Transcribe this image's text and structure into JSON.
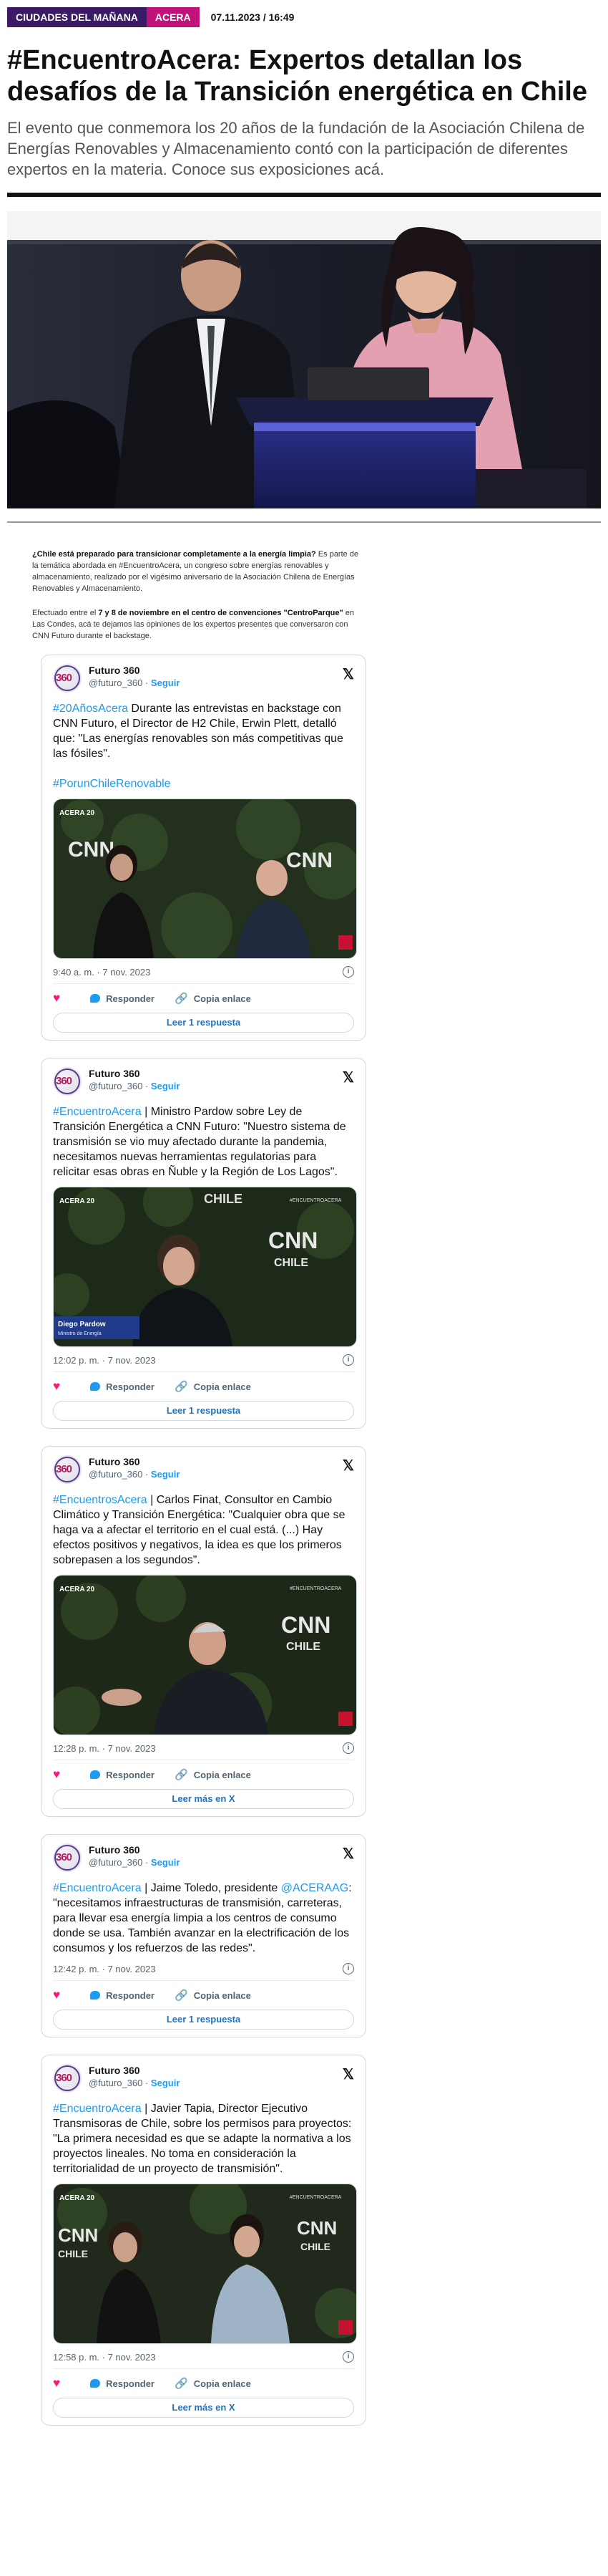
{
  "header": {
    "section": "CIUDADES DEL MAÑANA",
    "category": "ACERA",
    "date": "07.11.2023 / 16:49"
  },
  "article": {
    "title": "#EncuentroAcera: Expertos detallan los desafíos de la Transición energética en Chile",
    "dek": "El evento que conmemora los 20 años de la fundación de la Asociación Chilena de Energías Renovables y Almacenamiento contó con la participación de diferentes expertos en la materia. Conoce sus exposiciones acá.",
    "p1_bold": "¿Chile está preparado para transicionar completamente a la energía limpia?",
    "p1_rest": " Es parte de la temática abordada en #EncuentroAcera, un congreso sobre energías renovables y almacenamiento, realizado por el vigésimo aniversario de la Asociación Chilena de Energías Renovables y Almacenamiento.",
    "p2_a": "Efectuado entre el ",
    "p2_bold1": "7 y 8 de noviembre en el centro de convenciones \"CentroParque\"",
    "p2_b": " en Las Condes, acá te dejamos las opiniones de los expertos presentes que conversaron con CNN Futuro durante el backstage."
  },
  "tweets": [
    {
      "name": "Futuro 360",
      "handle": "@futuro_360",
      "follow": "Seguir",
      "hashtag": "#20AñosAcera",
      "text": " Durante las entrevistas en backstage con CNN Futuro, el Director de H2 Chile, Erwin Plett, detalló que:  \"Las energías renovables son más competitivas que las fósiles\".",
      "tail_hashtag": "#PorunChileRenovable",
      "time": "9:40 a. m. · 7 nov. 2023",
      "reply": "Responder",
      "copy": "Copia enlace",
      "more": "Leer 1 respuesta"
    },
    {
      "name": "Futuro 360",
      "handle": "@futuro_360",
      "follow": "Seguir",
      "hashtag": "#EncuentroAcera",
      "text": " | Ministro Pardow sobre Ley de Transición Energética a CNN Futuro: \"Nuestro sistema de transmisión se vio muy afectado durante la pandemia, necesitamos nuevas herramientas regulatorias para relicitar esas obras en Ñuble y la Región de Los Lagos\".",
      "time": "12:02 p. m. · 7 nov. 2023",
      "reply": "Responder",
      "copy": "Copia enlace",
      "more": "Leer 1 respuesta",
      "overlay_name": "Diego Pardow",
      "overlay_role": "Ministro de Energía"
    },
    {
      "name": "Futuro 360",
      "handle": "@futuro_360",
      "follow": "Seguir",
      "hashtag": "#EncuentrosAcera",
      "text": " | Carlos Finat, Consultor en Cambio Climático y Transición Energética: \"Cualquier obra que se haga va a afectar el territorio en el cual está. (...) Hay efectos positivos y negativos, la idea es que los primeros sobrepasen a los segundos\".",
      "time": "12:28 p. m. · 7 nov. 2023",
      "reply": "Responder",
      "copy": "Copia enlace",
      "more": "Leer más en X"
    },
    {
      "name": "Futuro 360",
      "handle": "@futuro_360",
      "follow": "Seguir",
      "hashtag": "#EncuentroAcera",
      "text_a": " | Jaime Toledo, presidente ",
      "mention": "@ACERAAG",
      "text_b": ": \"necesitamos  infraestructuras de transmisión, carreteras, para llevar esa energía limpia a los centros de consumo donde se usa. También avanzar en la electrificación de los consumos y los refuerzos de las redes\".",
      "time": "12:42 p. m. · 7 nov. 2023",
      "reply": "Responder",
      "copy": "Copia enlace",
      "more": "Leer 1 respuesta"
    },
    {
      "name": "Futuro 360",
      "handle": "@futuro_360",
      "follow": "Seguir",
      "hashtag": "#EncuentroAcera",
      "text": " | Javier Tapia, Director Ejecutivo Transmisoras de Chile, sobre los permisos para proyectos: \"La primera necesidad es que se adapte la normativa a los proyectos lineales. No toma en consideración la territorialidad de un proyecto de transmisión\".",
      "time": "12:58 p. m. · 7 nov. 2023",
      "reply": "Responder",
      "copy": "Copia enlace",
      "more": "Leer más en X"
    }
  ],
  "media": {
    "brand": "CNN",
    "country": "CHILE",
    "logo": "ACERA 20",
    "hashtag": "#ENCUENTROACERA"
  },
  "avatar_text": "360",
  "x_logo": "𝕏",
  "colors": {
    "section": "#3b1a66",
    "category": "#c0127a",
    "link": "#1d9bf0"
  }
}
